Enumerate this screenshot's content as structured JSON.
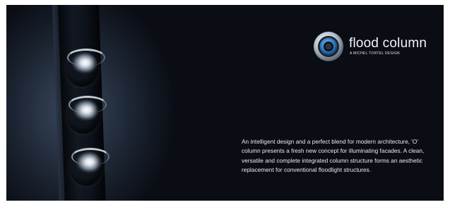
{
  "brand": {
    "name": "flood column",
    "tagline": "A MICHEL TORTEL DESIGN",
    "icon": "ring-logo-icon",
    "accent_color": "#2f7fc4"
  },
  "description": "An intelligent design and a perfect blend for modern architecture, 'O' column presents a fresh new concept for illuminating facades. A clean, versatile and complete integrated column structure forms an aesthetic replacement for conventional floodlight structures."
}
